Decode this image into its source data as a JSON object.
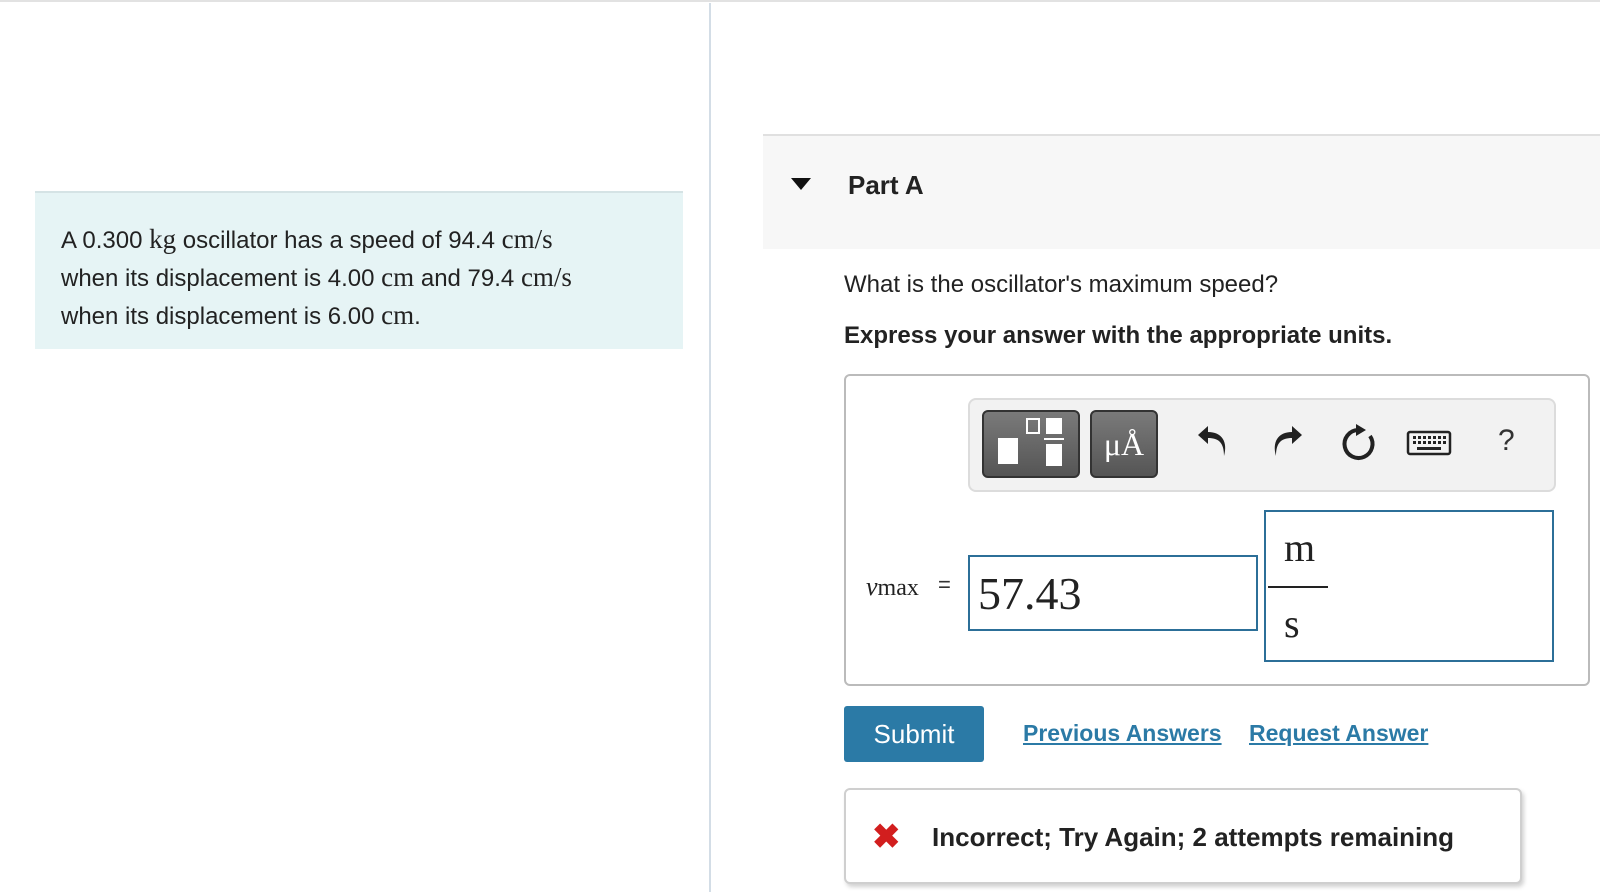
{
  "problem": {
    "t1": "A 0.300 ",
    "mass_unit": "kg",
    "t2": " oscillator has a speed of 94.4 ",
    "speed_unit_1": "cm/s",
    "t3": "when its displacement is 4.00 ",
    "disp_unit_1": "cm",
    "t4": " and 79.4 ",
    "speed_unit_2": "cm/s",
    "t5": "when its displacement is 6.00 ",
    "disp_unit_2": "cm",
    "t6": "."
  },
  "part": {
    "title": "Part A",
    "question": "What is the oscillator's maximum speed?",
    "instruction": "Express your answer with the appropriate units."
  },
  "toolbar": {
    "units_glyph": "μÅ",
    "help": "?"
  },
  "answer": {
    "var_symbol": "v",
    "var_subscript": "max",
    "equals": "=",
    "value": "57.43",
    "unit_numerator": "m",
    "unit_denominator": "s"
  },
  "actions": {
    "submit": "Submit",
    "previous_answers": "Previous Answers",
    "request_answer": "Request Answer"
  },
  "feedback": {
    "icon": "✖",
    "message": "Incorrect; Try Again; 2 attempts remaining"
  },
  "colors": {
    "accent": "#2b7aa6",
    "problem_bg": "#e6f4f5",
    "error": "#d21e1e"
  }
}
